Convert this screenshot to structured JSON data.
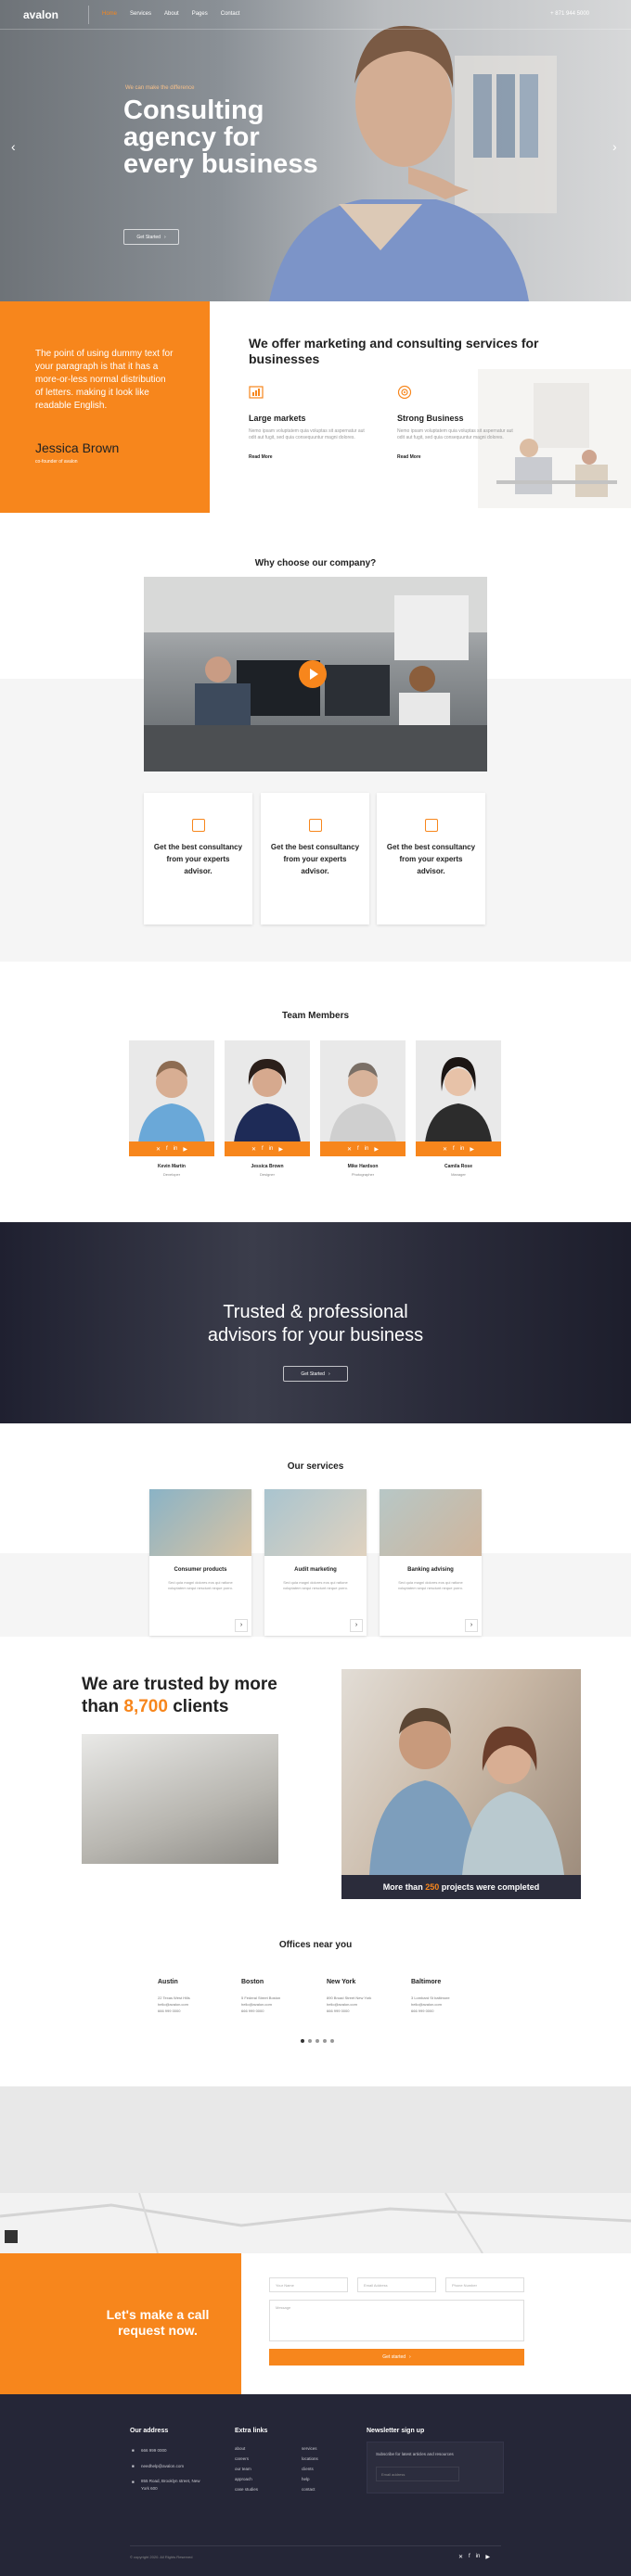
{
  "nav": {
    "logo": "avalon",
    "items": [
      "Home",
      "Services",
      "About",
      "Pages",
      "Contact"
    ],
    "phone": "+ 871 944 5000"
  },
  "hero": {
    "kicker": "We can make the difference",
    "title": "Consulting agency for every business",
    "button": "Get Started",
    "prev": "‹",
    "next": "›"
  },
  "quote": {
    "text": "The point of using dummy text for your paragraph is that it has a more-or-less normal distribution of letters. making it look like readable English.",
    "name": "Jessica Brown",
    "role": "co-founder of avalon"
  },
  "offer": {
    "title": "We offer marketing and consulting services for businesses",
    "features": [
      {
        "title": "Large markets",
        "text": "Nemo ipsam voluptatem quia voluptas sit aspernatur aut odit aut fugit, sed quia consequuntur magni dolores.",
        "link": "Read More"
      },
      {
        "title": "Strong Business",
        "text": "Nemo ipsam voluptatem quia voluptas sit aspernatur aut odit aut fugit, sed quia consequuntur magni dolores.",
        "link": "Read More"
      }
    ]
  },
  "why": {
    "title": "Why choose our company?",
    "cards": [
      "Get the best consultancy from your experts advisor.",
      "Get the best consultancy from your experts advisor.",
      "Get the best consultancy from your experts advisor."
    ]
  },
  "team": {
    "title": "Team Members",
    "members": [
      {
        "name": "Kevin Martin",
        "role": "Developer"
      },
      {
        "name": "Jessica Brown",
        "role": "Designer"
      },
      {
        "name": "Mike Hardson",
        "role": "Photographer"
      },
      {
        "name": "Camila Rose",
        "role": "Manager"
      }
    ],
    "social": [
      "✕",
      "f",
      "in",
      "▶"
    ]
  },
  "trusted": {
    "title": "Trusted & professional advisors for your business",
    "button": "Get Started"
  },
  "services": {
    "title": "Our services",
    "items": [
      {
        "title": "Consumer products",
        "text": "Sed quia magni dolores eos qui ratione voluptatem sequi nesciunt neque porro."
      },
      {
        "title": "Audit marketing",
        "text": "Sed quia magni dolores eos qui ratione voluptatem sequi nesciunt neque porro."
      },
      {
        "title": "Banking advising",
        "text": "Sed quia magni dolores eos qui ratione voluptatem sequi nesciunt neque porro."
      }
    ]
  },
  "clients": {
    "title_a": "We are trusted by more than",
    "count": "8,700",
    "title_b": "clients",
    "strip_a": "More than",
    "strip_count": "250",
    "strip_b": "projects were completed"
  },
  "offices": {
    "title": "Offices near you",
    "list": [
      {
        "city": "Austin",
        "lines": [
          "22 Texas West Hills",
          "hello@avalon.com",
          "666 999 0000"
        ]
      },
      {
        "city": "Boston",
        "lines": [
          "5 Federal Street Boston",
          "hello@avalon.com",
          "666 999 0000"
        ]
      },
      {
        "city": "New York",
        "lines": [
          "890 Broad Street New York",
          "hello@avalon.com",
          "666 999 0000"
        ]
      },
      {
        "city": "Baltimore",
        "lines": [
          "3 Lombard St baltimore",
          "hello@avalon.com",
          "666 999 0000"
        ]
      }
    ]
  },
  "call": {
    "title": "Let's make a call request now.",
    "placeholders": {
      "name": "Your Name",
      "email": "Email Address",
      "phone": "Phone Number",
      "message": "Message"
    },
    "button": "Get started"
  },
  "footer": {
    "address_title": "Our address",
    "address": [
      "666 999 0000",
      "needhelp@avalon.com",
      "855 Road, Brooklyn street, New York 600"
    ],
    "links_title": "Extra links",
    "links_a": [
      "about",
      "careers",
      "our team",
      "approach",
      "case studies"
    ],
    "links_b": [
      "services",
      "locations",
      "clients",
      "help",
      "contact"
    ],
    "newsletter_title": "Newsletter sign up",
    "newsletter_text": "Subscribe for latest articles and resources",
    "newsletter_placeholder": "Email address",
    "copyright": "© copyright 2020. All Rights Reserved",
    "social": [
      "✕",
      "f",
      "in",
      "▶"
    ]
  },
  "colors": {
    "accent": "#f7861c",
    "dark": "#252637"
  }
}
